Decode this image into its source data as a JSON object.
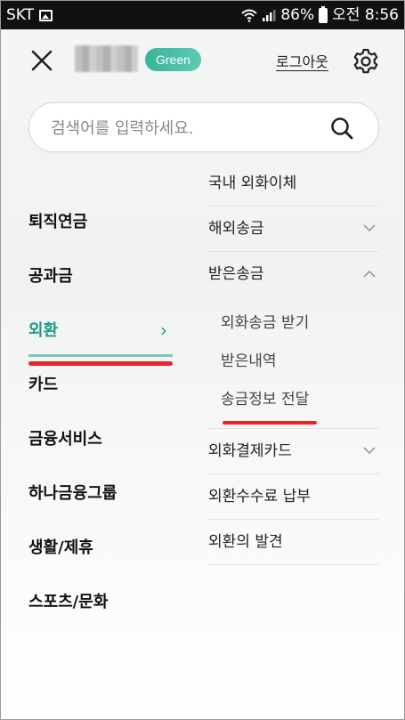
{
  "status_bar": {
    "carrier": "SKT",
    "battery": "86%",
    "time": "오전 8:56"
  },
  "header": {
    "badge": "Green",
    "logout": "로그아웃",
    "icons": [
      "close-icon",
      "gear-icon"
    ]
  },
  "search": {
    "placeholder": "검색어를 입력하세요.",
    "value": ""
  },
  "left_menu": {
    "items": [
      {
        "label": "퇴직연금"
      },
      {
        "label": "공과금"
      },
      {
        "label": "외환",
        "active": true
      },
      {
        "label": "카드"
      },
      {
        "label": "금융서비스"
      },
      {
        "label": "하나금융그룹"
      },
      {
        "label": "생활/제휴"
      },
      {
        "label": "스포츠/문화"
      }
    ],
    "active_chevron": "›"
  },
  "right_menu": {
    "items": [
      {
        "label": "국내 외화이체"
      },
      {
        "label": "해외송금",
        "chevron": "﹀"
      },
      {
        "label": "받은송금",
        "chevron": "︿",
        "expanded": true,
        "children": [
          {
            "label": "외화송금 받기"
          },
          {
            "label": "받은내역"
          },
          {
            "label": "송금정보 전달"
          }
        ]
      },
      {
        "label": "외화결제카드",
        "chevron": "﹀"
      },
      {
        "label": "외환수수료 납부"
      },
      {
        "label": "외환의 발견"
      }
    ]
  },
  "colors": {
    "accent": "#1a9a8a",
    "badge": "#36b59a",
    "highlight_red": "#e8242b"
  }
}
